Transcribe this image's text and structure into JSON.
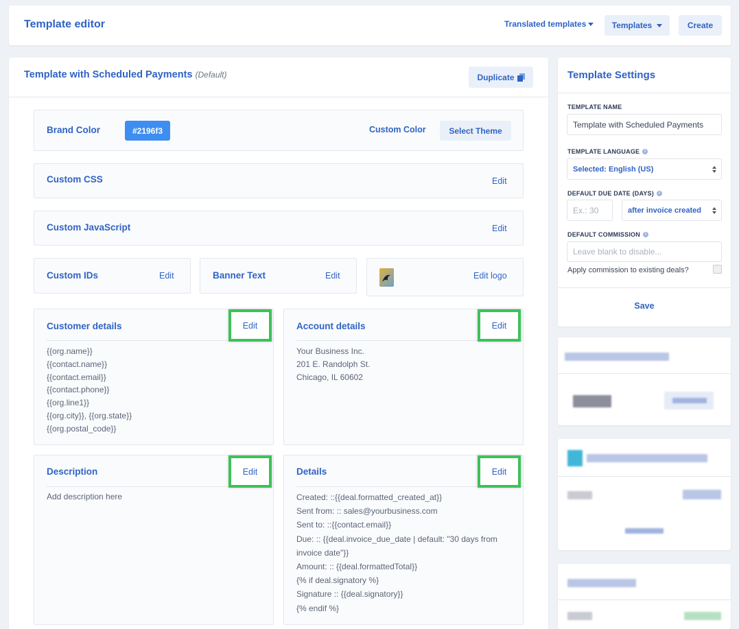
{
  "header": {
    "title": "Template editor",
    "translated_templates_label": "Translated templates",
    "templates_label": "Templates",
    "create_label": "Create"
  },
  "editor": {
    "title": "Template with Scheduled Payments",
    "default_tag": "(Default)",
    "duplicate_label": "Duplicate",
    "brand_color": {
      "label": "Brand Color",
      "value": "#2196f3",
      "custom_color_label": "Custom Color",
      "select_theme_label": "Select Theme"
    },
    "custom_css": {
      "label": "Custom CSS",
      "edit_label": "Edit"
    },
    "custom_js": {
      "label": "Custom JavaScript",
      "edit_label": "Edit"
    },
    "custom_ids": {
      "label": "Custom IDs",
      "edit_label": "Edit"
    },
    "banner_text": {
      "label": "Banner Text",
      "edit_label": "Edit"
    },
    "logo": {
      "edit_label": "Edit logo"
    },
    "customer_details": {
      "title": "Customer details",
      "edit_label": "Edit",
      "lines": [
        "{{org.name}}",
        "{{contact.name}}",
        "{{contact.email}}",
        "{{contact.phone}}",
        "{{org.line1}}",
        "{{org.city}}, {{org.state}}",
        "{{org.postal_code}}"
      ]
    },
    "account_details": {
      "title": "Account details",
      "edit_label": "Edit",
      "lines": [
        "Your Business Inc.",
        "201 E. Randolph St.",
        "Chicago, IL 60602"
      ]
    },
    "description": {
      "title": "Description",
      "edit_label": "Edit",
      "placeholder": "Add description here"
    },
    "details": {
      "title": "Details",
      "edit_label": "Edit",
      "lines": [
        "Created: ::{{deal.formatted_created_at}}",
        "Sent from: :: sales@yourbusiness.com",
        "Sent to: ::{{contact.email}}",
        "Due: :: {{deal.invoice_due_date | default: \"30 days from",
        "invoice date\"}}",
        "Amount: :: {{deal.formattedTotal}}",
        "{% if deal.signatory %}",
        "Signature :: {{deal.signatory}}",
        "{% endif %}"
      ]
    }
  },
  "settings": {
    "title": "Template Settings",
    "template_name_label": "TEMPLATE NAME",
    "template_name_value": "Template with Scheduled Payments",
    "language_label": "TEMPLATE LANGUAGE",
    "language_value": "Selected: English (US)",
    "due_date_label": "DEFAULT DUE DATE (DAYS)",
    "due_date_placeholder": "Ex.: 30",
    "due_date_option": "after invoice created",
    "commission_label": "DEFAULT COMMISSION",
    "commission_placeholder": "Leave blank to disable...",
    "apply_commission_label": "Apply commission to existing deals?",
    "save_label": "Save"
  },
  "colors": {
    "accent": "#2f63c4",
    "brand_swatch": "#3d8ef0",
    "highlight": "#3ec15a"
  }
}
